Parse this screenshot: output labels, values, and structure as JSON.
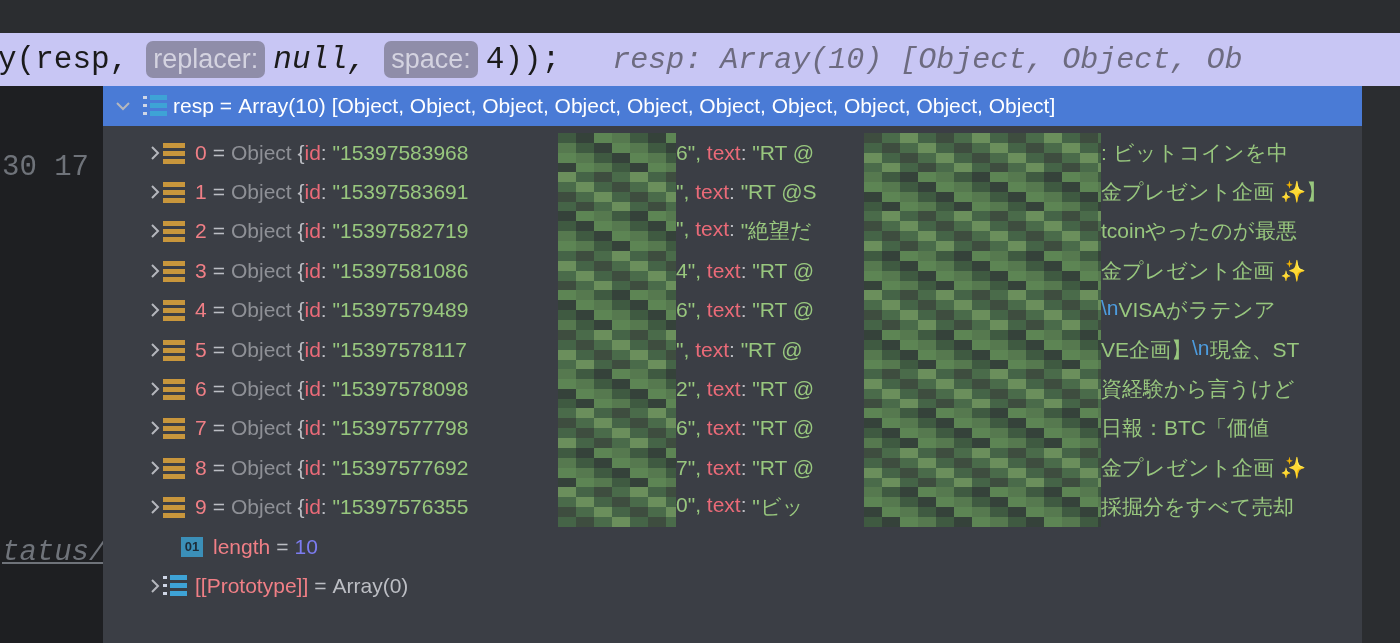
{
  "code_line": {
    "segments": [
      {
        "kind": "code",
        "text": "y(resp,"
      },
      {
        "kind": "hint",
        "text": "replacer:"
      },
      {
        "kind": "italic",
        "text": "null,"
      },
      {
        "kind": "hint",
        "text": "space:"
      },
      {
        "kind": "code",
        "text": "4));"
      }
    ],
    "inline_value": "resp: Array(10) [Object, Object, Ob"
  },
  "editor": {
    "gutter_text": "30 17",
    "link_text": "tatus/"
  },
  "popup": {
    "header": {
      "name": "resp",
      "separator": "=",
      "value": "Array(10)",
      "preview": "[Object, Object, Object, Object, Object, Object, Object, Object, Object, Object]",
      "expanded": true,
      "selected": true
    },
    "rows": [
      {
        "index": "0",
        "separator": "=",
        "type": "Object",
        "brace": "{",
        "expanded": false,
        "selected": false,
        "key_1": "id",
        "colon_1": ":",
        "id_start": "\"15397583968",
        "id_end": "6\",",
        "key_2": "text",
        "colon_2": ":",
        "text_start": "\"RT @",
        "text_end": [
          {
            "kind": "plain",
            "text": ": ビットコインを中"
          }
        ]
      },
      {
        "index": "1",
        "separator": "=",
        "type": "Object",
        "brace": "{",
        "expanded": false,
        "selected": false,
        "key_1": "id",
        "colon_1": ":",
        "id_start": "\"15397583691",
        "id_end": "\",",
        "key_2": "text",
        "colon_2": ":",
        "text_start": "\"RT @S",
        "text_end": [
          {
            "kind": "plain",
            "text": "金プレゼント企画 ✨】"
          }
        ]
      },
      {
        "index": "2",
        "separator": "=",
        "type": "Object",
        "brace": "{",
        "expanded": false,
        "selected": false,
        "key_1": "id",
        "colon_1": ":",
        "id_start": "\"15397582719",
        "id_end": "\",",
        "key_2": "text",
        "colon_2": ":",
        "text_start": "\"絶望だ",
        "text_end": [
          {
            "kind": "plain",
            "text": "tcoinやったのが最悪"
          }
        ]
      },
      {
        "index": "3",
        "separator": "=",
        "type": "Object",
        "brace": "{",
        "expanded": false,
        "selected": false,
        "key_1": "id",
        "colon_1": ":",
        "id_start": "\"15397581086",
        "id_end": "4\",",
        "key_2": "text",
        "colon_2": ":",
        "text_start": "\"RT @",
        "text_end": [
          {
            "kind": "plain",
            "text": "金プレゼント企画 ✨"
          }
        ]
      },
      {
        "index": "4",
        "separator": "=",
        "type": "Object",
        "brace": "{",
        "expanded": false,
        "selected": false,
        "key_1": "id",
        "colon_1": ":",
        "id_start": "\"15397579489",
        "id_end": "6\",",
        "key_2": "text",
        "colon_2": ":",
        "text_start": "\"RT @",
        "text_end": [
          {
            "kind": "escape",
            "text": "\\n"
          },
          {
            "kind": "plain",
            "text": "VISAがラテンア"
          }
        ]
      },
      {
        "index": "5",
        "separator": "=",
        "type": "Object",
        "brace": "{",
        "expanded": false,
        "selected": false,
        "key_1": "id",
        "colon_1": ":",
        "id_start": "\"15397578117",
        "id_end": "\",",
        "key_2": "text",
        "colon_2": ":",
        "text_start": "\"RT @",
        "text_end": [
          {
            "kind": "plain",
            "text": "VE企画】"
          },
          {
            "kind": "escape",
            "text": "\\n"
          },
          {
            "kind": "plain",
            "text": "現金、ST"
          }
        ]
      },
      {
        "index": "6",
        "separator": "=",
        "type": "Object",
        "brace": "{",
        "expanded": false,
        "selected": false,
        "key_1": "id",
        "colon_1": ":",
        "id_start": "\"15397578098",
        "id_end": "2\",",
        "key_2": "text",
        "colon_2": ":",
        "text_start": "\"RT @",
        "text_end": [
          {
            "kind": "plain",
            "text": "資経験から言うけど"
          }
        ]
      },
      {
        "index": "7",
        "separator": "=",
        "type": "Object",
        "brace": "{",
        "expanded": false,
        "selected": false,
        "key_1": "id",
        "colon_1": ":",
        "id_start": "\"15397577798",
        "id_end": "6\",",
        "key_2": "text",
        "colon_2": ":",
        "text_start": "\"RT @",
        "text_end": [
          {
            "kind": "plain",
            "text": "日報：BTC「価値"
          }
        ]
      },
      {
        "index": "8",
        "separator": "=",
        "type": "Object",
        "brace": "{",
        "expanded": false,
        "selected": false,
        "key_1": "id",
        "colon_1": ":",
        "id_start": "\"15397577692",
        "id_end": "7\",",
        "key_2": "text",
        "colon_2": ":",
        "text_start": "\"RT @",
        "text_end": [
          {
            "kind": "plain",
            "text": "金プレゼント企画 ✨"
          }
        ]
      },
      {
        "index": "9",
        "separator": "=",
        "type": "Object",
        "brace": "{",
        "expanded": false,
        "selected": false,
        "key_1": "id",
        "colon_1": ":",
        "id_start": "\"15397576355",
        "id_end": "0\",",
        "key_2": "text",
        "colon_2": ":",
        "text_start": "\"ビッ",
        "text_end": [
          {
            "kind": "plain",
            "text": "採掘分をすべて売却"
          }
        ]
      }
    ],
    "length": {
      "icon": "01",
      "name": "length",
      "separator": "=",
      "value": "10"
    },
    "prototype": {
      "name": "[[Prototype]]",
      "separator": "=",
      "value": "Array(0)",
      "expanded": false
    }
  }
}
